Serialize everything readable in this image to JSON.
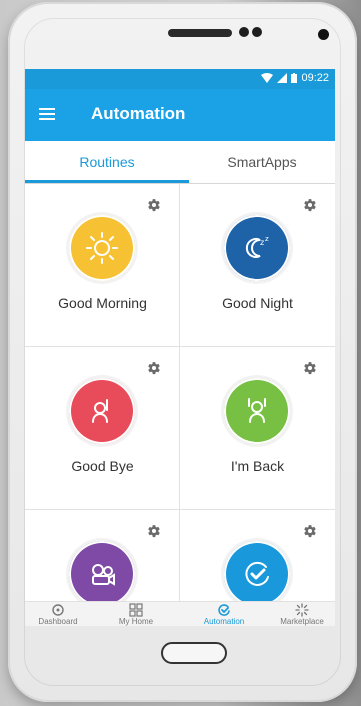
{
  "status": {
    "time": "09:22"
  },
  "appbar": {
    "title": "Automation",
    "menu_icon": "hamburger-menu-icon"
  },
  "tabs": [
    {
      "label": "Routines",
      "active": true
    },
    {
      "label": "SmartApps",
      "active": false
    }
  ],
  "routines": [
    {
      "label": "Good Morning",
      "icon": "sun-icon",
      "color": "#F6C233"
    },
    {
      "label": "Good Night",
      "icon": "moon-sleep-icon",
      "color": "#1E63A7"
    },
    {
      "label": "Good Bye",
      "icon": "waving-hand-icon",
      "color": "#E84C5A"
    },
    {
      "label": "I'm Back",
      "icon": "hands-up-person-icon",
      "color": "#78C043"
    },
    {
      "label": "",
      "icon": "video-camera-icon",
      "color": "#7E4AA6"
    },
    {
      "label": "",
      "icon": "check-refresh-icon",
      "color": "#1A98DC"
    }
  ],
  "bottom_nav": [
    {
      "label": "Dashboard",
      "icon": "dashboard-icon"
    },
    {
      "label": "My Home",
      "icon": "grid-icon"
    },
    {
      "label": "Automation",
      "icon": "automation-check-icon",
      "active": true
    },
    {
      "label": "Marketplace",
      "icon": "sparkle-icon"
    }
  ],
  "colors": {
    "primary": "#1AA1E6",
    "status_bar": "#1A9AD8",
    "active_tab": "#1A9AD8"
  }
}
